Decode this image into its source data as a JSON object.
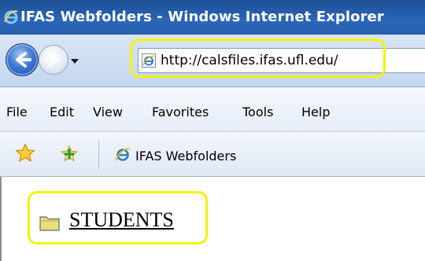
{
  "window": {
    "title": "IFAS Webfolders - Windows Internet Explorer"
  },
  "navigation": {
    "back_icon": "back-arrow-icon",
    "forward_icon": "forward-arrow-icon",
    "address": "http://calsfiles.ifas.ufl.edu/"
  },
  "menu": {
    "items": [
      "File",
      "Edit",
      "View",
      "Favorites",
      "Tools",
      "Help"
    ]
  },
  "favorites_bar": {
    "tab_title": "IFAS Webfolders"
  },
  "content": {
    "folder_link": "STUDENTS"
  },
  "colors": {
    "titlebar": "#285fae",
    "highlight": "#f5f200",
    "folder": "#e8de7a"
  }
}
